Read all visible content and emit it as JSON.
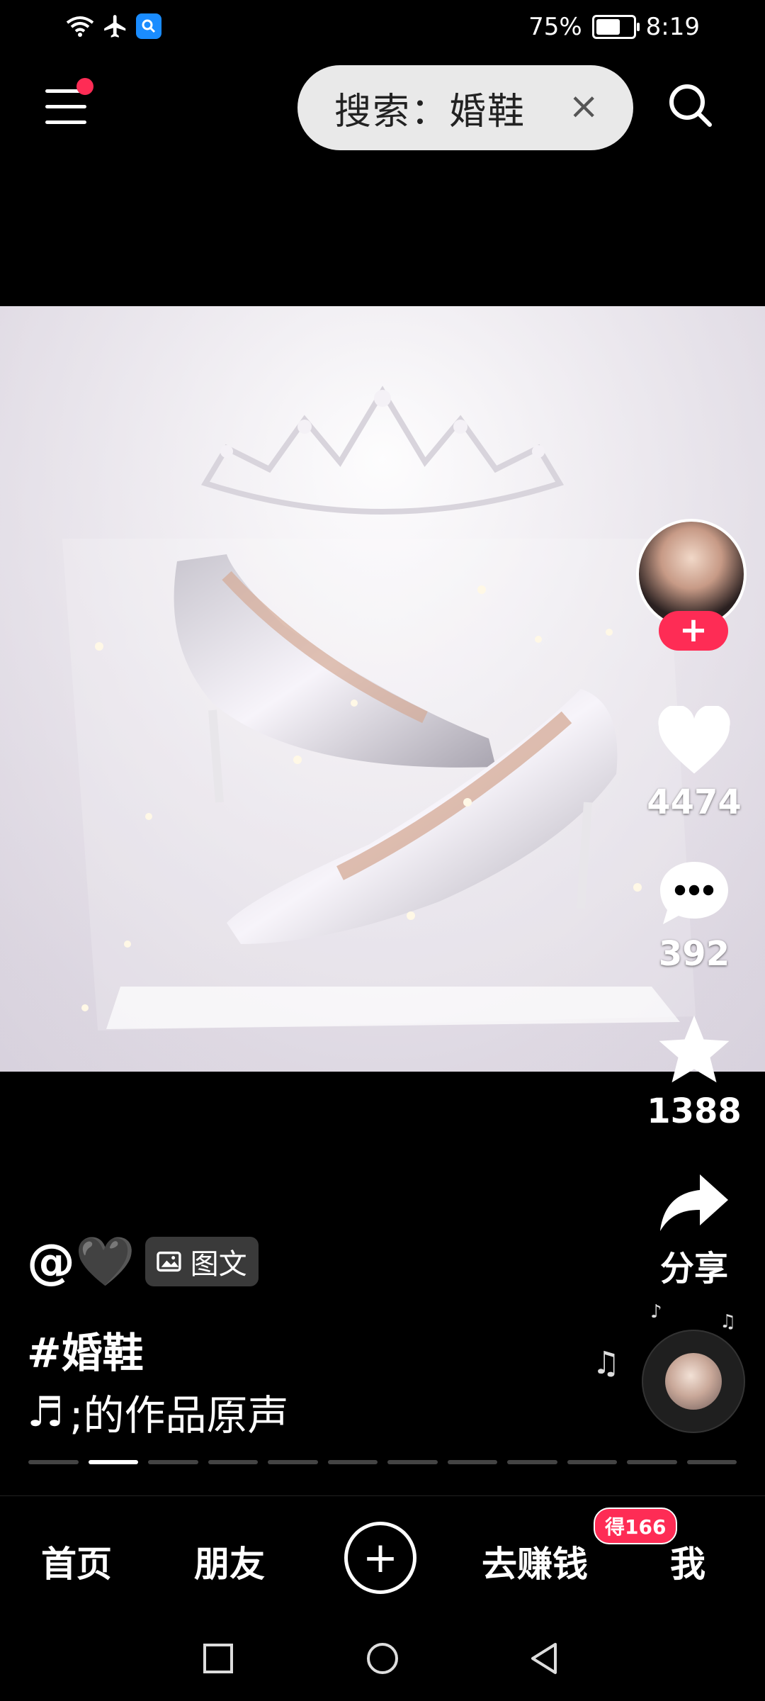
{
  "status_bar": {
    "battery": "75%",
    "battery_level": 0.75,
    "time": "8:19",
    "icons": [
      "wifi-icon",
      "airplane-icon",
      "search-app-icon"
    ]
  },
  "top_bar": {
    "search_text": "搜索：婚鞋",
    "clear": "×"
  },
  "rail": {
    "likes": "4474",
    "comments": "392",
    "favorites": "1388",
    "share": "分享",
    "follow": "+"
  },
  "caption": {
    "author": "@🖤",
    "type_tag": "图文",
    "hashtag": "#婚鞋",
    "music": ";的作品原声",
    "music_symbol": "♬"
  },
  "carousel": {
    "count": 12,
    "active_index": 1
  },
  "nav": {
    "home": "首页",
    "friends": "朋友",
    "add": "+",
    "earn": "去赚钱",
    "earn_badge": "得166",
    "me": "我"
  },
  "colors": {
    "accent": "#fe2c55",
    "background": "#000000"
  }
}
